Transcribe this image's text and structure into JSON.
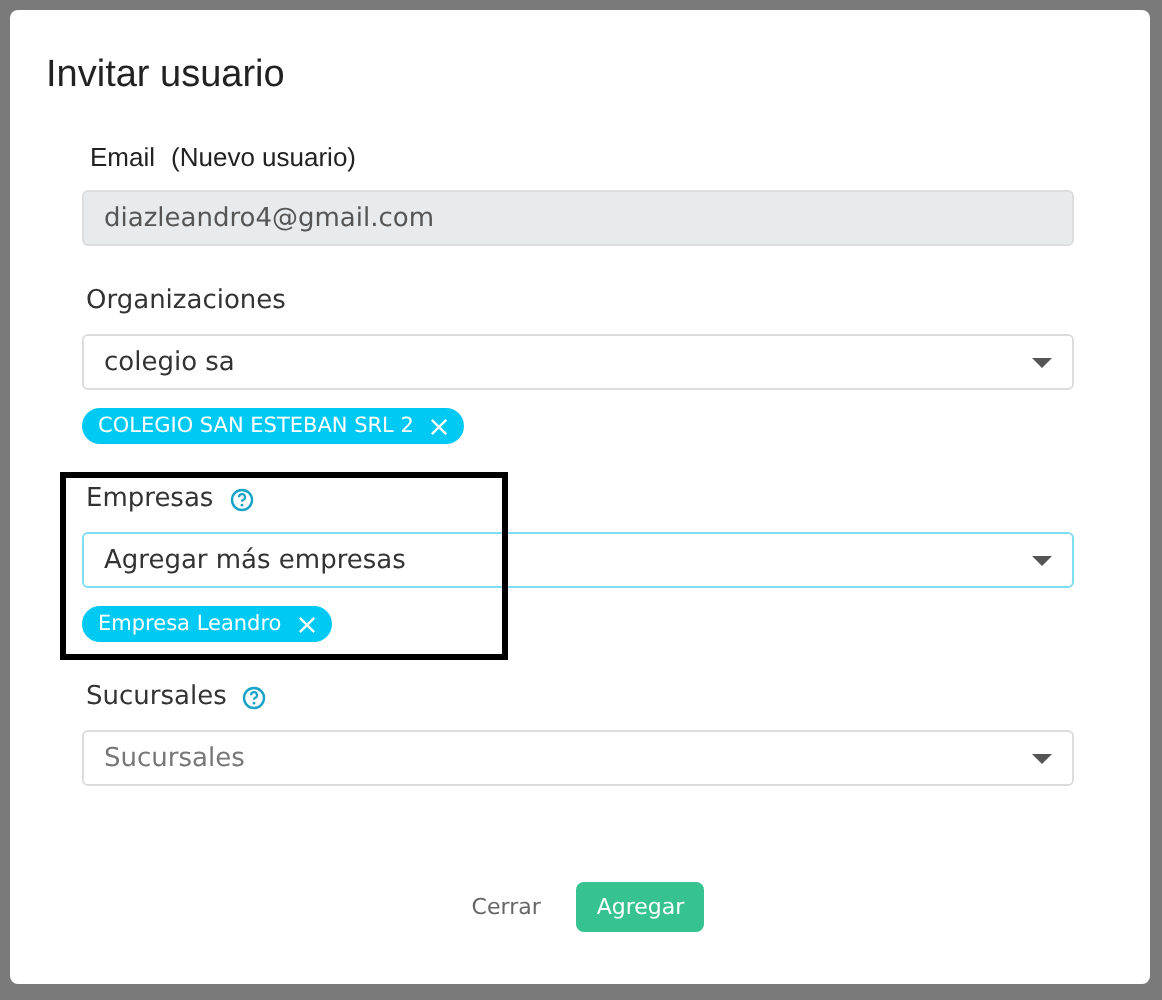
{
  "dialog": {
    "title": "Invitar usuario"
  },
  "email": {
    "label": "Email",
    "note": "(Nuevo usuario)",
    "value": "diazleandro4@gmail.com",
    "disabled": true
  },
  "fields": [
    {
      "label": "Organizaciones",
      "help": false,
      "value": "colegio sa",
      "focused": false,
      "chips": [
        "COLEGIO SAN ESTEBAN SRL 2"
      ],
      "highlighted": false
    },
    {
      "label": "Empresas",
      "help": true,
      "value": "Agregar más empresas",
      "focused": true,
      "chips": [
        "Empresa Leandro"
      ],
      "highlighted": true
    },
    {
      "label": "Sucursales",
      "help": true,
      "placeholder": "Sucursales",
      "focused": false,
      "highlighted": false
    }
  ],
  "buttons": [
    {
      "label": "Cerrar",
      "kind": "link"
    },
    {
      "label": "Agregar",
      "kind": "primary"
    }
  ]
}
